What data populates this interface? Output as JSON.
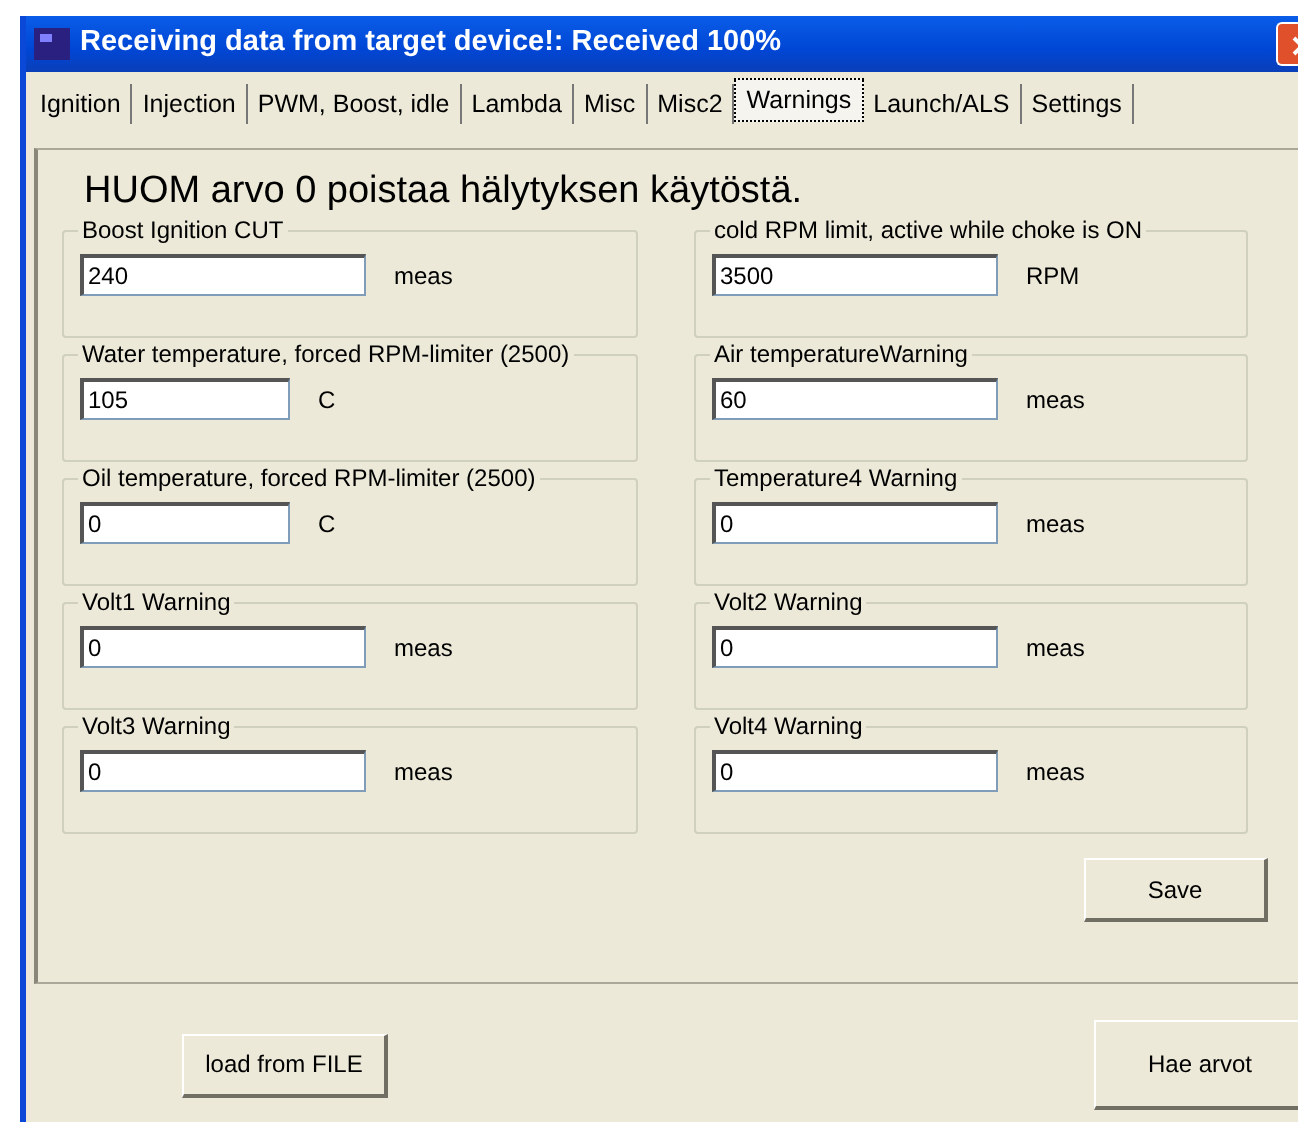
{
  "window": {
    "title": "Receiving data from target device!:  Received 100%"
  },
  "tabs": [
    {
      "label": "Ignition",
      "selected": false
    },
    {
      "label": "Injection",
      "selected": false
    },
    {
      "label": "PWM, Boost, idle",
      "selected": false
    },
    {
      "label": "Lambda",
      "selected": false
    },
    {
      "label": "Misc",
      "selected": false
    },
    {
      "label": "Misc2",
      "selected": false
    },
    {
      "label": "Warnings",
      "selected": true
    },
    {
      "label": "Launch/ALS",
      "selected": false
    },
    {
      "label": "Settings",
      "selected": false
    }
  ],
  "heading": "HUOM arvo 0 poistaa hälytyksen käytöstä.",
  "left_groups": [
    {
      "label": "Boost Ignition CUT",
      "value": "240",
      "unit": "meas",
      "kind": "long"
    },
    {
      "label": "Water temperature, forced RPM-limiter (2500)",
      "value": "105",
      "unit": "C",
      "kind": "short"
    },
    {
      "label": "Oil temperature, forced RPM-limiter (2500)",
      "value": "0",
      "unit": "C",
      "kind": "short"
    },
    {
      "label": "Volt1 Warning",
      "value": "0",
      "unit": "meas",
      "kind": "long"
    },
    {
      "label": "Volt3 Warning",
      "value": "0",
      "unit": "meas",
      "kind": "long"
    }
  ],
  "right_groups": [
    {
      "label": "cold RPM limit, active while choke is ON",
      "value": "3500",
      "unit": "RPM",
      "kind": "long"
    },
    {
      "label": "Air temperatureWarning",
      "value": "60",
      "unit": "meas",
      "kind": "long"
    },
    {
      "label": "Temperature4 Warning",
      "value": "0",
      "unit": "meas",
      "kind": "long"
    },
    {
      "label": "Volt2 Warning",
      "value": "0",
      "unit": "meas",
      "kind": "long"
    },
    {
      "label": "Volt4 Warning",
      "value": "0",
      "unit": "meas",
      "kind": "long"
    }
  ],
  "save_button": "Save",
  "load_button": "load from FILE",
  "fetch_button": "Hae arvot"
}
